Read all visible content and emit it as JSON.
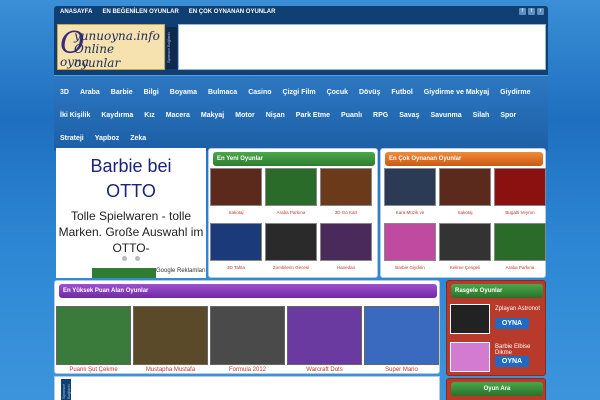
{
  "topnav": {
    "items": [
      "ANASAYFA",
      "EN BEĞENİLEN OYUNLAR",
      "EN ÇOK OYNANAN OYUNLAR"
    ]
  },
  "social": [
    "f",
    "t",
    "r"
  ],
  "logo": {
    "big": "O",
    "line1": "yunuoyna.info",
    "line2": "Online oyunlar",
    "line3": "oyna"
  },
  "sponsor_label": "Sponsor Bağlantı",
  "categories": {
    "row1": [
      "3D",
      "Araba",
      "Barbie",
      "Bilgi",
      "Boyama",
      "Bulmaca",
      "Casino",
      "Çizgi Film",
      "Çocuk",
      "Dövüş",
      "Futbol",
      "Giydirme ve Makyaj",
      "Giydirme"
    ],
    "row2": [
      "İki Kişilik",
      "Kaydırma",
      "Kız",
      "Macera",
      "Makyaj",
      "Motor",
      "Nişan",
      "Park Etme",
      "Puanlı",
      "RPG",
      "Savaş",
      "Savunma",
      "Silah",
      "Spor"
    ],
    "row3": [
      "Strateji",
      "Yapboz",
      "Zeka"
    ]
  },
  "ad": {
    "title1": "Barbie bei",
    "title2": "OTTO",
    "desc": "Tolle Spielwaren - tolle Marken. Große Auswahl im OTTO-",
    "google": "Google Reklamları"
  },
  "newest": {
    "title": "En Yeni Oyunlar",
    "games": [
      "Sakotaj",
      "Araba Parkına",
      "3D Go Kart",
      "3D Tahta",
      "Zombilerin Gecesi",
      "Hanedan"
    ]
  },
  "most_played": {
    "title": "En Çok Oynanan Oyunlar",
    "games": [
      "Kara Müzik ve",
      "Sakotaj",
      "Bugatti Veyron",
      "Barbie Giydirin",
      "Kelime Çengeli",
      "Araba Parkına"
    ]
  },
  "top_rated": {
    "title": "En Yüksek Puan Alan Oyunlar",
    "games": [
      "Puanlı Şut Çekme",
      "Mustapha Mustafa",
      "Formula 2012",
      "Warcraft Dots",
      "Super Mario"
    ]
  },
  "random": {
    "title": "Rasgele Oyunlar",
    "items": [
      {
        "label": "Zplayan Astronot",
        "button": "OYNA"
      },
      {
        "label": "Barbie Elbise Dikme",
        "button": "OYNA"
      }
    ]
  },
  "search": {
    "title": "Oyun Ara"
  },
  "colors": {
    "nav": "#0f3f73",
    "menu": "#1c5fa6",
    "label_red": "#c0392b",
    "button_blue": "#1d6bc4"
  }
}
